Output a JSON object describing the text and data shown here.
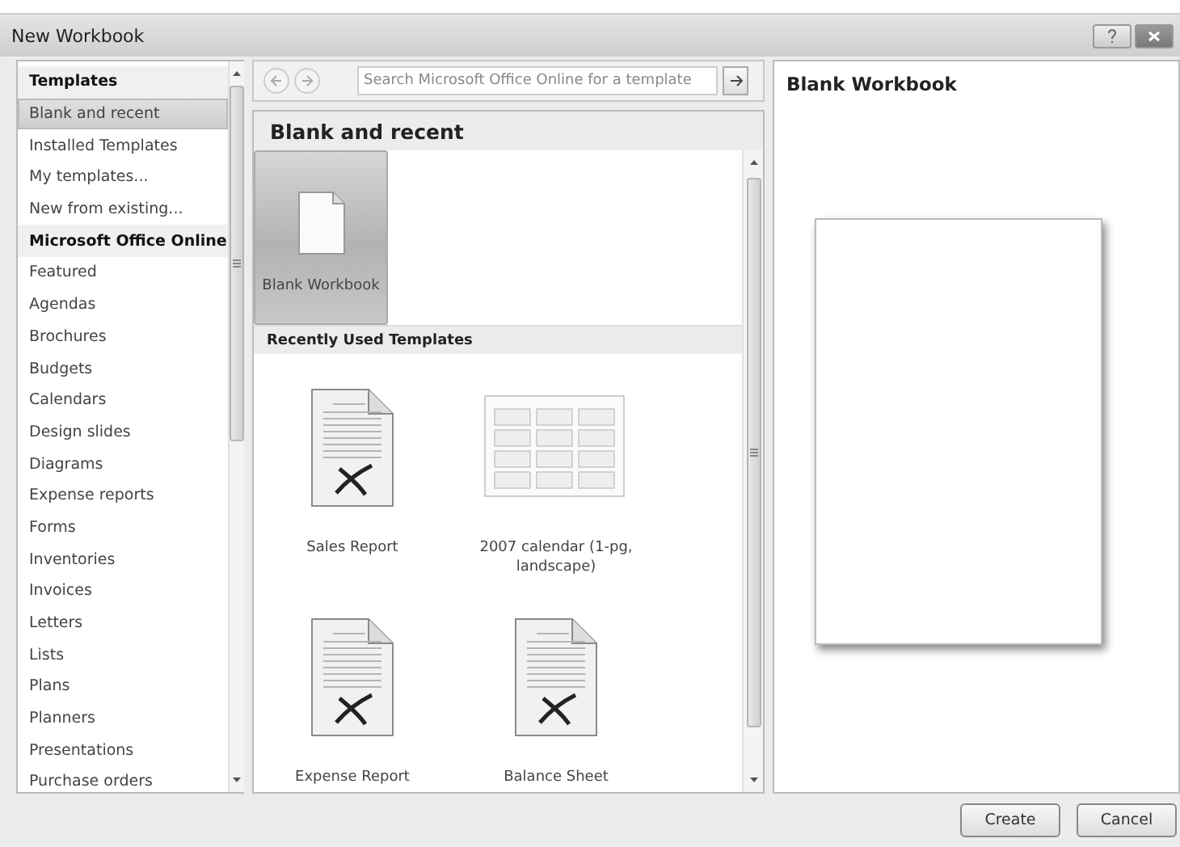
{
  "window": {
    "title": "New Workbook"
  },
  "sidebar": {
    "items": [
      {
        "kind": "header",
        "label": "Templates",
        "selected": false
      },
      {
        "kind": "item",
        "label": "Blank and recent",
        "selected": true
      },
      {
        "kind": "item",
        "label": "Installed Templates",
        "selected": false
      },
      {
        "kind": "item",
        "label": "My templates...",
        "selected": false
      },
      {
        "kind": "item",
        "label": "New from existing...",
        "selected": false
      },
      {
        "kind": "header",
        "label": "Microsoft Office Online",
        "selected": false
      },
      {
        "kind": "item",
        "label": "Featured",
        "selected": false
      },
      {
        "kind": "item",
        "label": "Agendas",
        "selected": false
      },
      {
        "kind": "item",
        "label": "Brochures",
        "selected": false
      },
      {
        "kind": "item",
        "label": "Budgets",
        "selected": false
      },
      {
        "kind": "item",
        "label": "Calendars",
        "selected": false
      },
      {
        "kind": "item",
        "label": "Design slides",
        "selected": false
      },
      {
        "kind": "item",
        "label": "Diagrams",
        "selected": false
      },
      {
        "kind": "item",
        "label": "Expense reports",
        "selected": false
      },
      {
        "kind": "item",
        "label": "Forms",
        "selected": false
      },
      {
        "kind": "item",
        "label": "Inventories",
        "selected": false
      },
      {
        "kind": "item",
        "label": "Invoices",
        "selected": false
      },
      {
        "kind": "item",
        "label": "Letters",
        "selected": false
      },
      {
        "kind": "item",
        "label": "Lists",
        "selected": false
      },
      {
        "kind": "item",
        "label": "Plans",
        "selected": false
      },
      {
        "kind": "item",
        "label": "Planners",
        "selected": false
      },
      {
        "kind": "item",
        "label": "Presentations",
        "selected": false
      },
      {
        "kind": "item",
        "label": "Purchase orders",
        "selected": false
      }
    ]
  },
  "search": {
    "placeholder": "Search Microsoft Office Online for a template"
  },
  "gallery": {
    "title": "Blank and recent",
    "featured": [
      {
        "kind": "blank",
        "label": "Blank Workbook",
        "selected": true
      }
    ],
    "subtitle": "Recently Used Templates",
    "recent": [
      {
        "kind": "document",
        "label": "Sales Report",
        "selected": false
      },
      {
        "kind": "calendar",
        "label": "2007 calendar (1-pg, landscape)",
        "selected": false
      },
      {
        "kind": "document",
        "label": "Expense Report",
        "selected": false
      },
      {
        "kind": "document",
        "label": "Balance Sheet",
        "selected": false
      }
    ]
  },
  "preview": {
    "title": "Blank Workbook"
  },
  "buttons": [
    "Create",
    "Cancel"
  ]
}
